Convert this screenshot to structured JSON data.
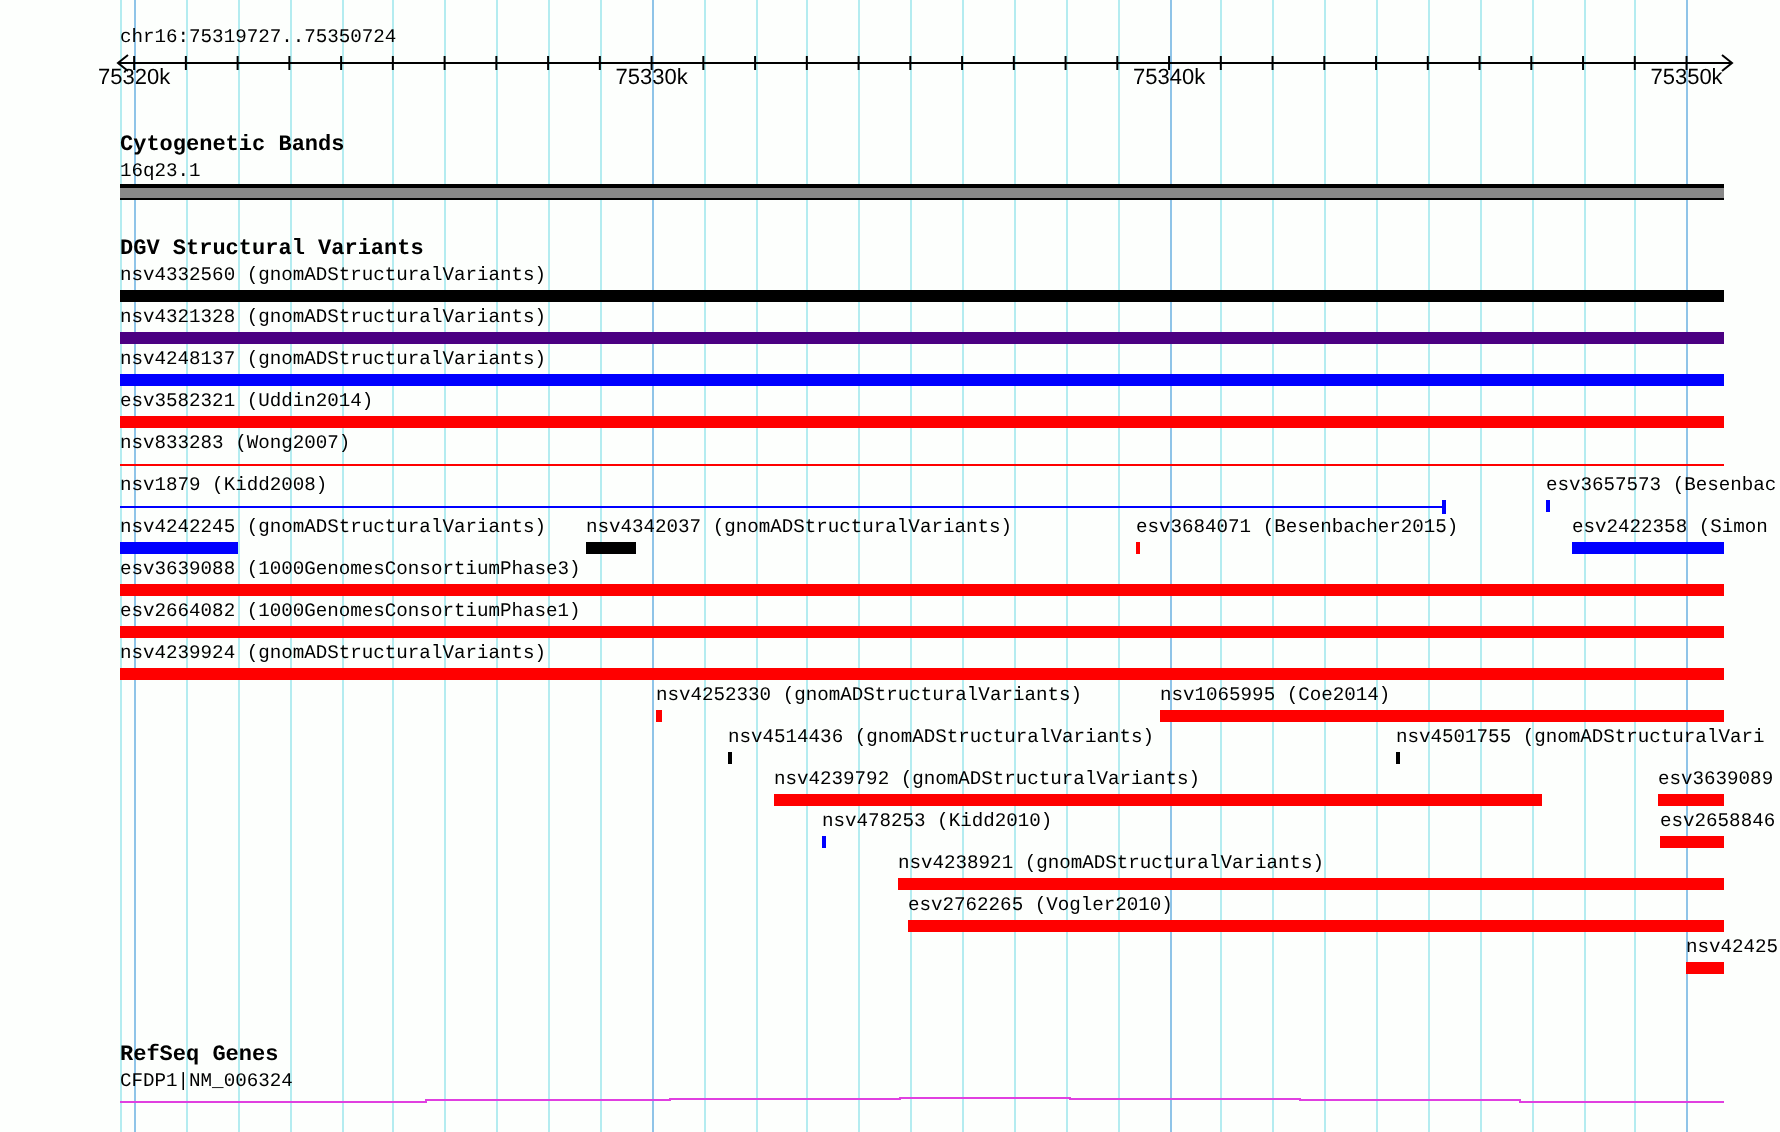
{
  "ruler": {
    "title": "chr16:75319727..75350724",
    "ticks": [
      {
        "label": "75320k"
      },
      {
        "label": "75330k"
      },
      {
        "label": "75340k"
      },
      {
        "label": "75350k"
      }
    ]
  },
  "cytoband_track": {
    "title": "Cytogenetic Bands",
    "label": "16q23.1"
  },
  "dgv_track": {
    "title": "DGV Structural Variants",
    "rows": [
      {
        "features": [
          {
            "kind": "bar",
            "label": "nsv4332560 (gnomADStructuralVariants)",
            "color": "#000000"
          }
        ]
      },
      {
        "features": [
          {
            "kind": "bar",
            "label": "nsv4321328 (gnomADStructuralVariants)",
            "color": "#4b0082"
          }
        ]
      },
      {
        "features": [
          {
            "kind": "bar",
            "label": "nsv4248137 (gnomADStructuralVariants)",
            "color": "#0000ff"
          }
        ]
      },
      {
        "features": [
          {
            "kind": "bar",
            "label": "esv3582321 (Uddin2014)",
            "color": "#ff0000"
          }
        ]
      },
      {
        "features": [
          {
            "kind": "line",
            "label": "nsv833283 (Wong2007)",
            "color": "#ff0000"
          }
        ]
      },
      {
        "features": [
          {
            "kind": "line",
            "label": "nsv1879 (Kidd2008)",
            "color": "#0000ff"
          },
          {
            "kind": "bar",
            "label": "esv3657573 (Besenbac",
            "color": "#0000ff"
          }
        ]
      },
      {
        "features": [
          {
            "kind": "bar",
            "label": "nsv4242245 (gnomADStructuralVariants)",
            "color": "#0000ff"
          },
          {
            "kind": "bar",
            "label": "nsv4342037 (gnomADStructuralVariants)",
            "color": "#000000"
          },
          {
            "kind": "bar",
            "label": "esv3684071 (Besenbacher2015)",
            "color": "#ff0000"
          },
          {
            "kind": "bar",
            "label": "esv2422358 (Simon",
            "color": "#0000ff"
          }
        ]
      },
      {
        "features": [
          {
            "kind": "bar",
            "label": "esv3639088 (1000GenomesConsortiumPhase3)",
            "color": "#ff0000"
          }
        ]
      },
      {
        "features": [
          {
            "kind": "bar",
            "label": "esv2664082 (1000GenomesConsortiumPhase1)",
            "color": "#ff0000"
          }
        ]
      },
      {
        "features": [
          {
            "kind": "bar",
            "label": "nsv4239924 (gnomADStructuralVariants)",
            "color": "#ff0000"
          }
        ]
      },
      {
        "features": [
          {
            "kind": "bar",
            "label": "nsv4252330 (gnomADStructuralVariants)",
            "color": "#ff0000"
          },
          {
            "kind": "bar",
            "label": "nsv1065995 (Coe2014)",
            "color": "#ff0000"
          }
        ]
      },
      {
        "features": [
          {
            "kind": "bar",
            "label": "nsv4514436 (gnomADStructuralVariants)",
            "color": "#000000"
          },
          {
            "kind": "bar",
            "label": "nsv4501755 (gnomADStructuralVari",
            "color": "#000000"
          }
        ]
      },
      {
        "features": [
          {
            "kind": "bar",
            "label": "nsv4239792 (gnomADStructuralVariants)",
            "color": "#ff0000"
          },
          {
            "kind": "bar",
            "label": "esv3639089",
            "color": "#ff0000"
          }
        ]
      },
      {
        "features": [
          {
            "kind": "bar",
            "label": "nsv478253 (Kidd2010)",
            "color": "#0000ff"
          },
          {
            "kind": "bar",
            "label": "esv2658846",
            "color": "#ff0000"
          }
        ]
      },
      {
        "features": [
          {
            "kind": "bar",
            "label": "nsv4238921 (gnomADStructuralVariants)",
            "color": "#ff0000"
          }
        ]
      },
      {
        "features": [
          {
            "kind": "bar",
            "label": "esv2762265 (Vogler2010)",
            "color": "#ff0000"
          }
        ]
      },
      {
        "features": [
          {
            "kind": "bar",
            "label": "nsv42425",
            "color": "#ff0000"
          }
        ]
      }
    ]
  },
  "refseq_track": {
    "title": "RefSeq Genes",
    "gene": {
      "label": "CFDP1|NM_006324"
    }
  }
}
